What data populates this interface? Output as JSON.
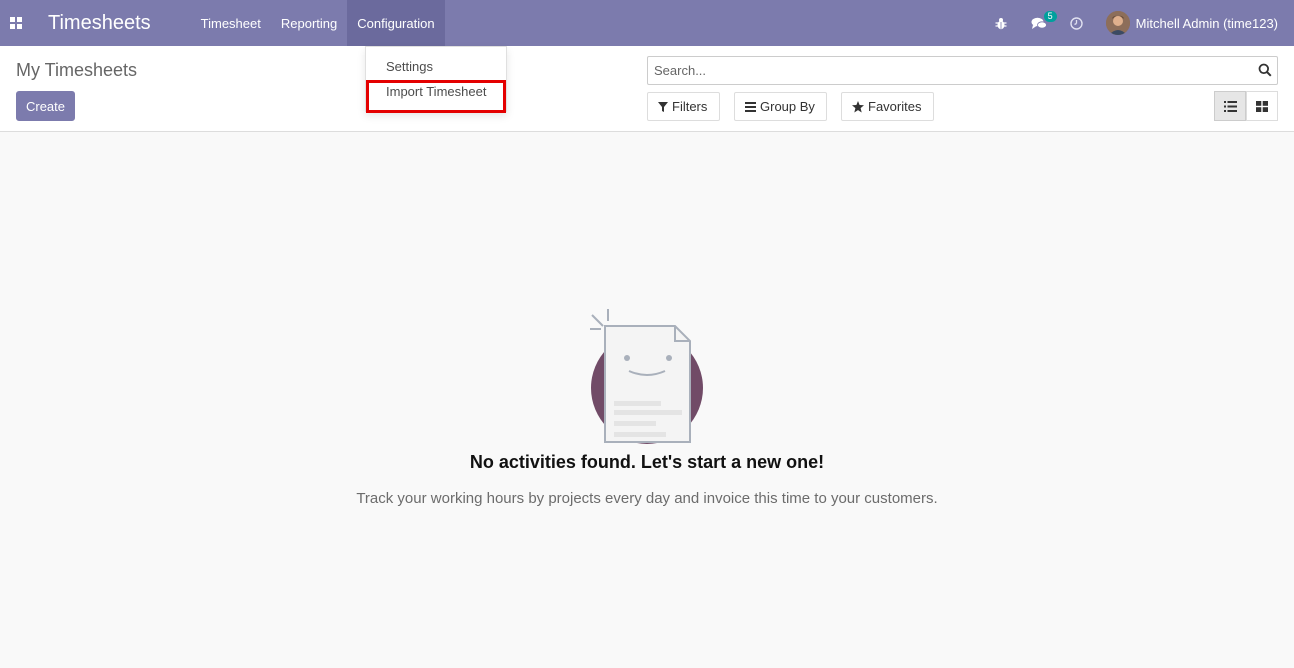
{
  "navbar": {
    "app_title": "Timesheets",
    "menu": [
      {
        "label": "Timesheet"
      },
      {
        "label": "Reporting"
      },
      {
        "label": "Configuration"
      }
    ],
    "messages_badge": "5",
    "user_name": "Mitchell Admin (time123)"
  },
  "dropdown": {
    "items": [
      {
        "label": "Settings"
      },
      {
        "label": "Import Timesheet"
      }
    ]
  },
  "control_panel": {
    "title": "My Timesheets",
    "create_label": "Create",
    "search_placeholder": "Search...",
    "filters_label": "Filters",
    "group_by_label": "Group By",
    "favorites_label": "Favorites"
  },
  "empty_state": {
    "title": "No activities found. Let's start a new one!",
    "text": "Track your working hours by projects every day and invoice this time to your customers."
  },
  "colors": {
    "brand": "#7c7bad",
    "highlight": "#e40000",
    "badge": "#00a09d"
  }
}
